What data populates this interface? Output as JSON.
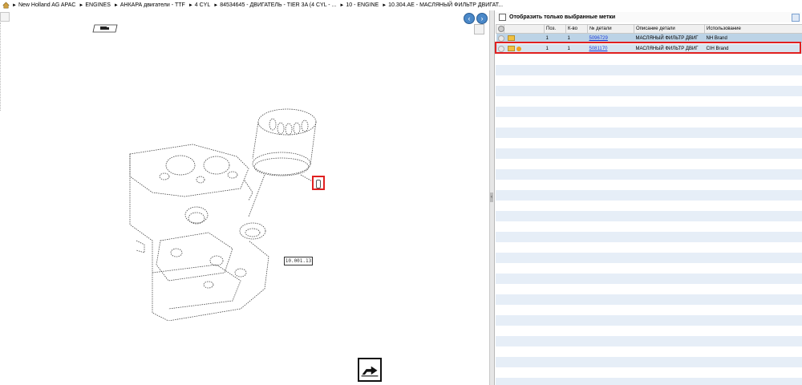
{
  "breadcrumb": {
    "items": [
      "New Holland AG APAC",
      "ENGINES",
      "АНКАРА двигатели - TTF",
      "4 CYL",
      "84534645 - ДВИГАТЕЛЬ - TIER 3A (4 CYL - ...",
      "10 - ENGINE",
      "10.304.AE - МАСЛЯНЫЙ ФИЛЬТР ДВИГАТ..."
    ]
  },
  "diagram": {
    "hotspot_label": "1",
    "reference_label": "10.001.13"
  },
  "right_panel": {
    "filter_label": "Отобразить только выбранные метки",
    "columns": [
      "",
      "",
      "Поз.",
      "К-во",
      "№ детали",
      "Описание детали",
      "Использование"
    ],
    "rows": [
      {
        "pos": "1",
        "qty": "1",
        "part": "5096729",
        "desc": "МАСЛЯНЫЙ ФИЛЬТР ДВИГ",
        "usage": "NH Brand"
      },
      {
        "pos": "1",
        "qty": "1",
        "part": "5081170",
        "desc": "МАСЛЯНЫЙ ФИЛЬТР ДВИГ",
        "usage": "CIH Brand"
      }
    ]
  },
  "colors": {
    "selection": "#e02020",
    "row_highlight": "#bcd3e6",
    "link": "#1a3cd9"
  }
}
